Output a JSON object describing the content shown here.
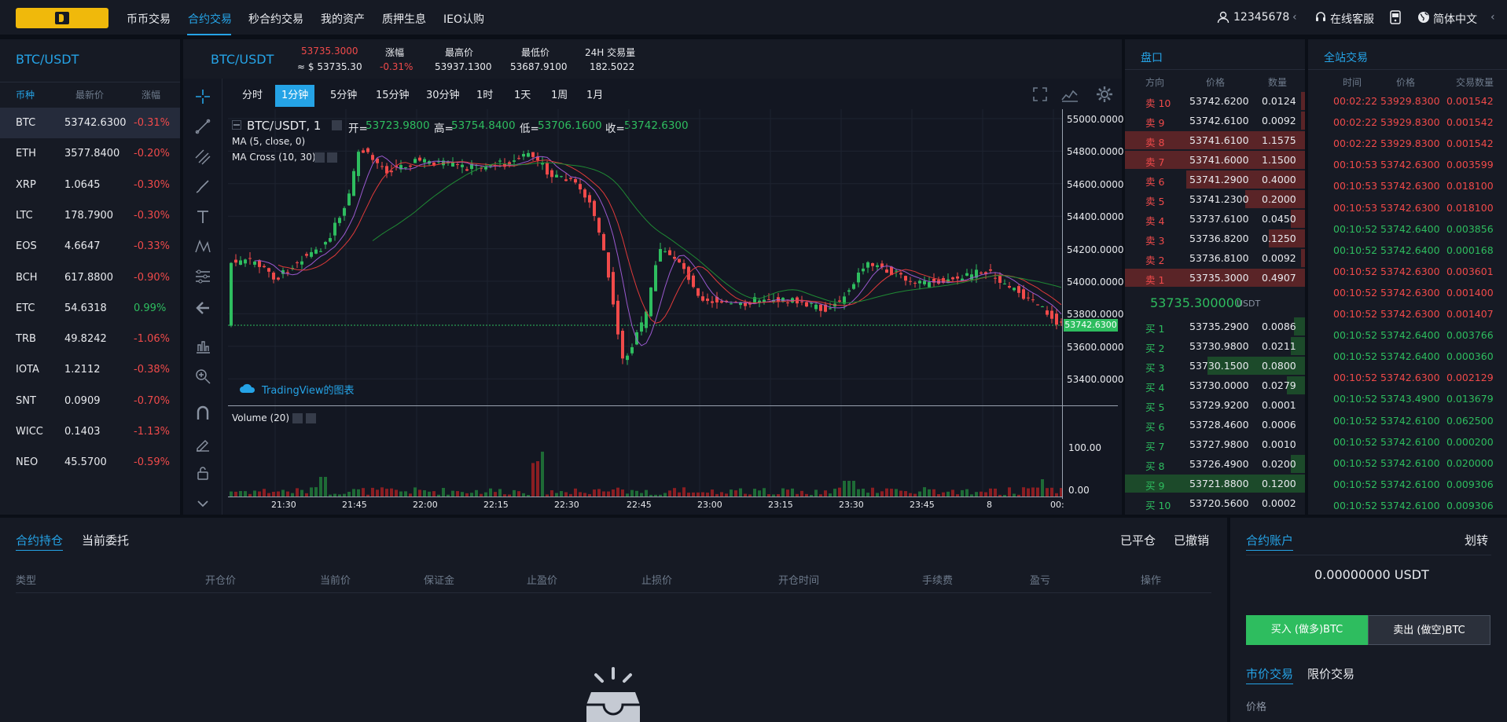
{
  "nav": {
    "links": [
      "币币交易",
      "合约交易",
      "秒合约交易",
      "我的资产",
      "质押生息",
      "IEO认购"
    ],
    "active_index": 1,
    "user": "12345678",
    "support": "在线客服",
    "language": "简体中文"
  },
  "market_list": {
    "title": "BTC/USDT",
    "headers": [
      "币种",
      "最新价",
      "涨幅"
    ],
    "rows": [
      {
        "coin": "BTC",
        "price": "53742.6300",
        "change": "-0.31%",
        "dir": "down"
      },
      {
        "coin": "ETH",
        "price": "3577.8400",
        "change": "-0.20%",
        "dir": "down"
      },
      {
        "coin": "XRP",
        "price": "1.0645",
        "change": "-0.30%",
        "dir": "down"
      },
      {
        "coin": "LTC",
        "price": "178.7900",
        "change": "-0.30%",
        "dir": "down"
      },
      {
        "coin": "EOS",
        "price": "4.6647",
        "change": "-0.33%",
        "dir": "down"
      },
      {
        "coin": "BCH",
        "price": "617.8800",
        "change": "-0.90%",
        "dir": "down"
      },
      {
        "coin": "ETC",
        "price": "54.6318",
        "change": "0.99%",
        "dir": "up"
      },
      {
        "coin": "TRB",
        "price": "49.8242",
        "change": "-1.06%",
        "dir": "down"
      },
      {
        "coin": "IOTA",
        "price": "1.2112",
        "change": "-0.38%",
        "dir": "down"
      },
      {
        "coin": "SNT",
        "price": "0.0909",
        "change": "-0.70%",
        "dir": "down"
      },
      {
        "coin": "WICC",
        "price": "0.1403",
        "change": "-1.13%",
        "dir": "down"
      },
      {
        "coin": "NEO",
        "price": "45.5700",
        "change": "-0.59%",
        "dir": "down"
      }
    ]
  },
  "ticker": {
    "symbol": "BTC/USDT",
    "price": "53735.3000",
    "price_usd": "≈ $ 53735.30",
    "change_label": "涨幅",
    "change": "-0.31%",
    "high_label": "最高价",
    "high": "53937.1300",
    "low_label": "最低价",
    "low": "53687.9100",
    "vol_label": "24H 交易量",
    "vol": "182.5022"
  },
  "chart": {
    "timeframes": [
      "分时",
      "1分钟",
      "5分钟",
      "15分钟",
      "30分钟",
      "1时",
      "1天",
      "1周",
      "1月"
    ],
    "active_tf": 1,
    "legend_symbol": "BTC/USDT, 1",
    "open_label": "开=",
    "open": "53723.9800",
    "high_label": "高=",
    "high": "53754.8400",
    "low_label": "低=",
    "low": "53706.1600",
    "close_label": "收=",
    "close": "53742.6300",
    "ma_label": "MA (5, close, 0)",
    "macross_label": "MA Cross (10, 30)",
    "volume_label": "Volume (20)",
    "watermark": "TradingView的图表",
    "y_ticks": [
      "55000.0000",
      "54800.0000",
      "54600.0000",
      "54400.0000",
      "54200.0000",
      "54000.0000",
      "53800.0000",
      "53600.0000",
      "53400.0000"
    ],
    "last_price_tag": "53742.6300",
    "vol_ticks": [
      "100.00",
      "0.00"
    ],
    "x_ticks": [
      "21:30",
      "21:45",
      "22:00",
      "22:15",
      "22:30",
      "22:45",
      "23:00",
      "23:15",
      "23:30",
      "23:45",
      "8",
      "00:"
    ]
  },
  "orderbook": {
    "title": "盘口",
    "headers": [
      "方向",
      "价格",
      "数量"
    ],
    "asks": [
      {
        "side": "卖 10",
        "price": "53742.6200",
        "qty": "0.0124",
        "depth": 0.02
      },
      {
        "side": "卖 9",
        "price": "53742.6100",
        "qty": "0.0092",
        "depth": 0.02
      },
      {
        "side": "卖 8",
        "price": "53741.6100",
        "qty": "1.1575",
        "depth": 1.0
      },
      {
        "side": "卖 7",
        "price": "53741.6000",
        "qty": "1.1500",
        "depth": 1.0
      },
      {
        "side": "卖 6",
        "price": "53741.2900",
        "qty": "0.4000",
        "depth": 0.66
      },
      {
        "side": "卖 5",
        "price": "53741.2300",
        "qty": "0.2000",
        "depth": 0.33
      },
      {
        "side": "卖 4",
        "price": "53737.6100",
        "qty": "0.0450",
        "depth": 0.08
      },
      {
        "side": "卖 3",
        "price": "53736.8200",
        "qty": "0.1250",
        "depth": 0.2
      },
      {
        "side": "卖 2",
        "price": "53736.8100",
        "qty": "0.0092",
        "depth": 0.02
      },
      {
        "side": "卖 1",
        "price": "53735.3000",
        "qty": "0.4907",
        "depth": 1.0
      }
    ],
    "mid_price": "53735.300000",
    "mid_unit": "USDT",
    "bids": [
      {
        "side": "买 1",
        "price": "53735.2900",
        "qty": "0.0086",
        "depth": 0.06
      },
      {
        "side": "买 2",
        "price": "53730.9800",
        "qty": "0.0211",
        "depth": 0.08
      },
      {
        "side": "买 3",
        "price": "53730.1500",
        "qty": "0.0800",
        "depth": 0.54
      },
      {
        "side": "买 4",
        "price": "53730.0000",
        "qty": "0.0279",
        "depth": 0.1
      },
      {
        "side": "买 5",
        "price": "53729.9200",
        "qty": "0.0001",
        "depth": 0.0
      },
      {
        "side": "买 6",
        "price": "53728.4600",
        "qty": "0.0006",
        "depth": 0.0
      },
      {
        "side": "买 7",
        "price": "53727.9800",
        "qty": "0.0010",
        "depth": 0.0
      },
      {
        "side": "买 8",
        "price": "53726.4900",
        "qty": "0.0200",
        "depth": 0.08
      },
      {
        "side": "买 9",
        "price": "53721.8800",
        "qty": "0.1200",
        "depth": 1.0
      },
      {
        "side": "买 10",
        "price": "53720.5600",
        "qty": "0.0002",
        "depth": 0.0
      }
    ]
  },
  "trades": {
    "title": "全站交易",
    "headers": [
      "时间",
      "价格",
      "交易数量"
    ],
    "rows": [
      {
        "time": "00:02:22",
        "price": "53929.8300",
        "qty": "0.001542",
        "dir": "down"
      },
      {
        "time": "00:02:22",
        "price": "53929.8300",
        "qty": "0.001542",
        "dir": "down"
      },
      {
        "time": "00:02:22",
        "price": "53929.8300",
        "qty": "0.001542",
        "dir": "down"
      },
      {
        "time": "00:10:53",
        "price": "53742.6300",
        "qty": "0.003599",
        "dir": "down"
      },
      {
        "time": "00:10:53",
        "price": "53742.6300",
        "qty": "0.018100",
        "dir": "down"
      },
      {
        "time": "00:10:53",
        "price": "53742.6300",
        "qty": "0.018100",
        "dir": "down"
      },
      {
        "time": "00:10:52",
        "price": "53742.6400",
        "qty": "0.003856",
        "dir": "up"
      },
      {
        "time": "00:10:52",
        "price": "53742.6400",
        "qty": "0.000168",
        "dir": "up"
      },
      {
        "time": "00:10:52",
        "price": "53742.6300",
        "qty": "0.003601",
        "dir": "down"
      },
      {
        "time": "00:10:52",
        "price": "53742.6300",
        "qty": "0.001400",
        "dir": "down"
      },
      {
        "time": "00:10:52",
        "price": "53742.6300",
        "qty": "0.001407",
        "dir": "down"
      },
      {
        "time": "00:10:52",
        "price": "53742.6400",
        "qty": "0.003766",
        "dir": "up"
      },
      {
        "time": "00:10:52",
        "price": "53742.6400",
        "qty": "0.000360",
        "dir": "up"
      },
      {
        "time": "00:10:52",
        "price": "53742.6300",
        "qty": "0.002129",
        "dir": "down"
      },
      {
        "time": "00:10:52",
        "price": "53743.4900",
        "qty": "0.013679",
        "dir": "up"
      },
      {
        "time": "00:10:52",
        "price": "53742.6100",
        "qty": "0.062500",
        "dir": "up"
      },
      {
        "time": "00:10:52",
        "price": "53742.6100",
        "qty": "0.000200",
        "dir": "up"
      },
      {
        "time": "00:10:52",
        "price": "53742.6100",
        "qty": "0.020000",
        "dir": "up"
      },
      {
        "time": "00:10:52",
        "price": "53742.6100",
        "qty": "0.009306",
        "dir": "up"
      },
      {
        "time": "00:10:52",
        "price": "53742.6100",
        "qty": "0.009306",
        "dir": "up"
      }
    ]
  },
  "positions": {
    "tab_holdings": "合约持仓",
    "tab_orders": "当前委托",
    "closed": "已平仓",
    "cancelled": "已撤销",
    "columns": [
      "类型",
      "开仓价",
      "当前价",
      "保证金",
      "止盈价",
      "止损价",
      "开仓时间",
      "手续费",
      "盈亏",
      "操作"
    ]
  },
  "account": {
    "title": "合约账户",
    "transfer": "划转",
    "balance": "0.00000000 USDT",
    "buy_btn": "买入 (做多)BTC",
    "sell_btn": "卖出 (做空)BTC",
    "tab_market": "市价交易",
    "tab_limit": "限价交易",
    "price_label": "价格"
  },
  "colors": {
    "accent": "#25a3e6",
    "up": "#2ebd5f",
    "down": "#f04a4a",
    "brand": "#f0b90b"
  }
}
